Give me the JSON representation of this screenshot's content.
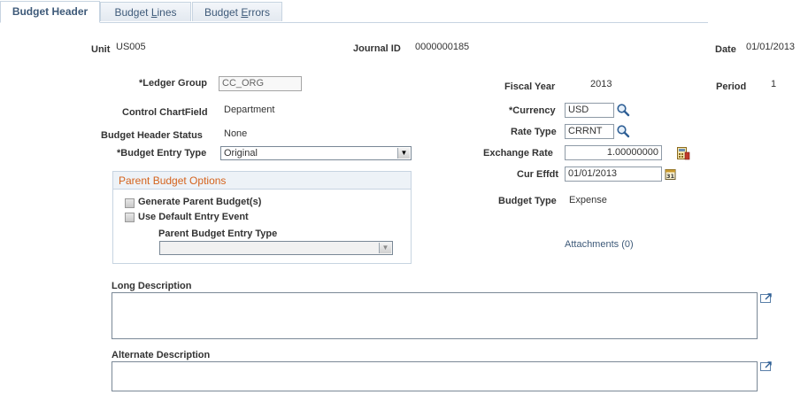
{
  "tabs": [
    {
      "label": "Budget Header",
      "active": true
    },
    {
      "label_pre": "Budget ",
      "label_u": "L",
      "label_post": "ines"
    },
    {
      "label_pre": "Budget ",
      "label_u": "E",
      "label_post": "rrors"
    }
  ],
  "header": {
    "unit_label": "Unit",
    "unit_value": "US005",
    "journal_label": "Journal ID",
    "journal_value": "0000000185",
    "date_label": "Date",
    "date_value": "01/01/2013"
  },
  "form": {
    "ledger_group_label": "*Ledger Group",
    "ledger_group_value": "CC_ORG",
    "control_chartfield_label": "Control ChartField",
    "control_chartfield_value": "Department",
    "status_label": "Budget Header Status",
    "status_value": "None",
    "entry_type_label": "*Budget Entry Type",
    "entry_type_value": "Original",
    "fiscal_year_label": "Fiscal Year",
    "fiscal_year_value": "2013",
    "period_label": "Period",
    "period_value": "1",
    "currency_label": "*Currency",
    "currency_value": "USD",
    "rate_type_label": "Rate Type",
    "rate_type_value": "CRRNT",
    "exchange_rate_label": "Exchange Rate",
    "exchange_rate_value": "1.00000000",
    "cur_effdt_label": "Cur Effdt",
    "cur_effdt_value": "01/01/2013",
    "budget_type_label": "Budget Type",
    "budget_type_value": "Expense"
  },
  "parent_options": {
    "title": "Parent Budget Options",
    "generate_label": "Generate Parent Budget(s)",
    "default_event_label": "Use Default Entry Event",
    "entry_type_label": "Parent Budget Entry Type",
    "entry_type_value": ""
  },
  "attachments_link": "Attachments (0)",
  "long_description_label": "Long Description",
  "alternate_description_label": "Alternate Description",
  "colors": {
    "accent": "#d5631d",
    "link": "#3e5a79",
    "border": "#c7d4e1"
  },
  "icons": [
    "search-icon",
    "calculator-icon",
    "calendar-icon",
    "expand-icon"
  ]
}
